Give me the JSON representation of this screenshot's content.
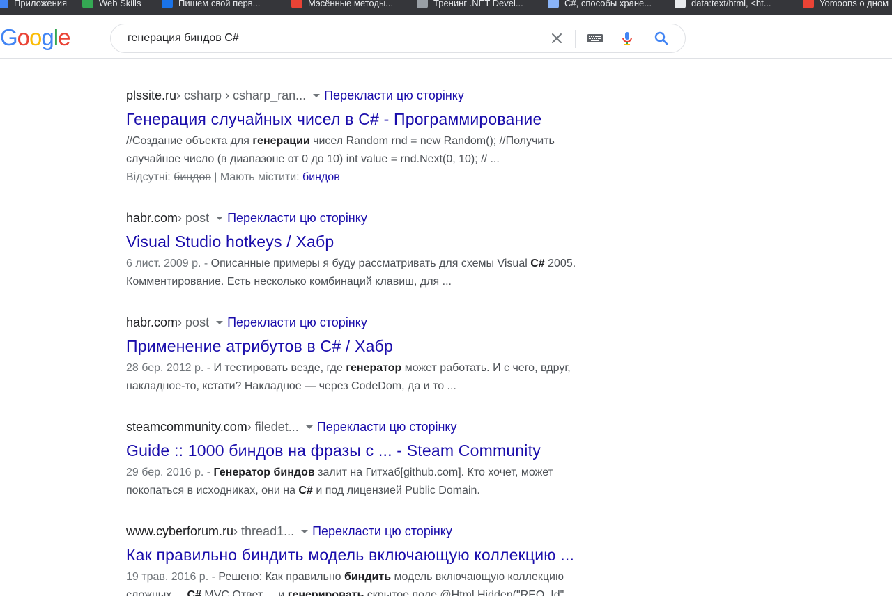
{
  "bookmarks": [
    {
      "label": "Приложения",
      "color": "#4285f4"
    },
    {
      "label": "Web Skills",
      "color": "#34a853"
    },
    {
      "label": "Пишем свой перв...",
      "color": "#1a73e8"
    },
    {
      "label": "Мэсённые методы...",
      "color": "#ea4335"
    },
    {
      "label": "Тренинг .NET Devel...",
      "color": "#9aa0a6"
    },
    {
      "label": "C#, способы хране...",
      "color": "#8ab4f8"
    },
    {
      "label": "data:text/html, <ht...",
      "color": "#e8eaed"
    },
    {
      "label": "Yomoons о дном",
      "color": "#ea4335"
    }
  ],
  "logo": {
    "letters": [
      "G",
      "o",
      "o",
      "g",
      "l",
      "e"
    ],
    "colors": [
      "#4285f4",
      "#ea4335",
      "#fbbc05",
      "#4285f4",
      "#34a853",
      "#ea4335"
    ]
  },
  "search": {
    "query": "генерация биндов C#",
    "icons": [
      "close-icon",
      "keyboard-icon",
      "microphone-icon",
      "search-icon"
    ]
  },
  "results": [
    {
      "domain": "plssite.ru",
      "crumb": " › csharp › csharp_ran...",
      "translate": "Перекласти цю сторінку",
      "title": "Генерация случайных чисел в C# - Программирование",
      "line1": [
        {
          "t": "//Создание объекта для ",
          "b": false
        },
        {
          "t": "генерации",
          "b": true
        },
        {
          "t": " чисел Random rnd = new Random(); //Получить",
          "b": false
        }
      ],
      "line2": [
        {
          "t": "случайное число (в диапазоне от 0 до 10) int value = rnd.Next(0, 10); // ...",
          "b": false
        }
      ],
      "missing": {
        "label": "Відсутні: ",
        "struck": "биндов",
        "sep": " | Мають містити: ",
        "link": "биндов"
      }
    },
    {
      "domain": "habr.com",
      "crumb": " › post",
      "translate": "Перекласти цю сторінку",
      "title": "Visual Studio hotkeys / Хабр",
      "date": "6 лист. 2009 р. - ",
      "line1": [
        {
          "t": "Описанные примеры я буду рассматривать для схемы Visual ",
          "b": false
        },
        {
          "t": "C#",
          "b": true
        },
        {
          "t": " 2005.",
          "b": false
        }
      ],
      "line2": [
        {
          "t": "Комментирование. Есть несколько комбинаций клавиш, для ...",
          "b": false
        }
      ]
    },
    {
      "domain": "habr.com",
      "crumb": " › post",
      "translate": "Перекласти цю сторінку",
      "title": "Применение атрибутов в C# / Хабр",
      "date": "28 бер. 2012 р. - ",
      "line1": [
        {
          "t": "И тестировать везде, где ",
          "b": false
        },
        {
          "t": "генератор",
          "b": true
        },
        {
          "t": " может работать. И с чего, вдруг,",
          "b": false
        }
      ],
      "line2": [
        {
          "t": "накладное-то, кстати? Накладное — через CodeDom, да и то ...",
          "b": false
        }
      ]
    },
    {
      "domain": "steamcommunity.com",
      "crumb": " › filedet...",
      "translate": "Перекласти цю сторінку",
      "title": "Guide :: 1000 биндов на фразы с ... - Steam Community",
      "date": "29 бер. 2016 р. - ",
      "line1": [
        {
          "t": "Генератор биндов",
          "b": true
        },
        {
          "t": " залит на Гитхаб[github.com]. Кто хочет, может",
          "b": false
        }
      ],
      "line2": [
        {
          "t": "покопаться в исходниках, они на ",
          "b": false
        },
        {
          "t": "C#",
          "b": true
        },
        {
          "t": " и под лицензией Public Domain.",
          "b": false
        }
      ]
    },
    {
      "domain": "www.cyberforum.ru",
      "crumb": " › thread1...",
      "translate": "Перекласти цю сторінку",
      "title": "Как правильно биндить модель включающую коллекцию ...",
      "date": "19 трав. 2016 р. - ",
      "line1": [
        {
          "t": "Решено: Как правильно ",
          "b": false
        },
        {
          "t": "биндить",
          "b": true
        },
        {
          "t": " модель включающую коллекцию",
          "b": false
        }
      ],
      "line2": [
        {
          "t": "сложных ... ",
          "b": false
        },
        {
          "t": "C#",
          "b": true
        },
        {
          "t": " MVC Ответ ... и ",
          "b": false
        },
        {
          "t": "генерировать",
          "b": true
        },
        {
          "t": " скрытое поле @Html.Hidden(\"REQ_Id\"",
          "b": false
        }
      ]
    }
  ]
}
